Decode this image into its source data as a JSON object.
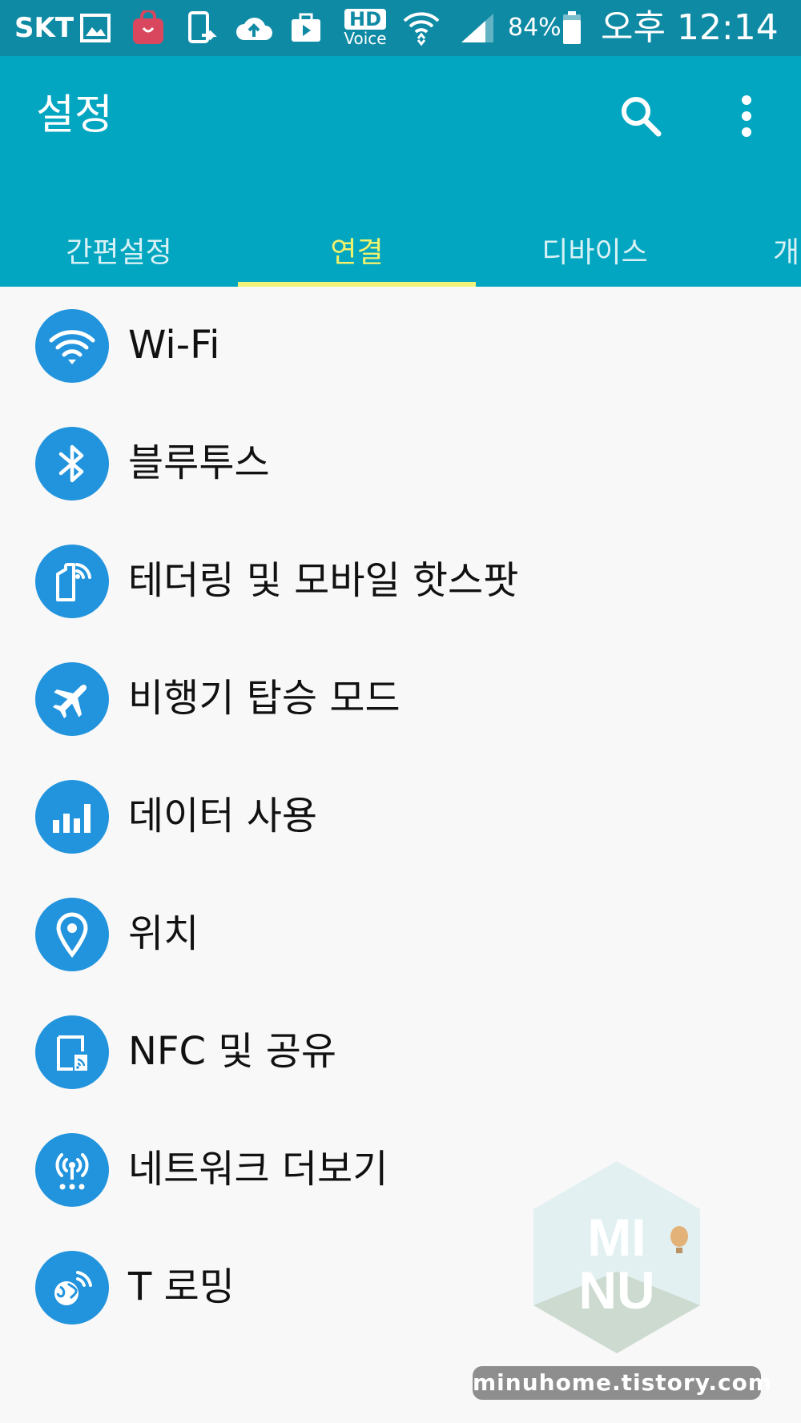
{
  "status_bar": {
    "carrier": "SKT",
    "hd_top": "HD",
    "hd_bottom": "Voice",
    "battery": "84%",
    "time": "오후 12:14",
    "icons": [
      "gallery-icon",
      "shopping-bag-icon",
      "phone-transfer-icon",
      "cloud-upload-icon",
      "briefcase-play-icon",
      "hd-voice-icon",
      "wifi-icon",
      "cell-signal-icon",
      "battery-icon"
    ]
  },
  "app_bar": {
    "title": "설정",
    "actions": [
      "search-icon",
      "more-vert-icon"
    ],
    "background": "#02a6c1"
  },
  "tabs": {
    "items": [
      {
        "label": "간편설정",
        "active": false
      },
      {
        "label": "연결",
        "active": true
      },
      {
        "label": "디바이스",
        "active": false
      },
      {
        "label": "개",
        "active": false
      }
    ],
    "active_color": "#f2f26b",
    "indicator_color": "#f0f27a"
  },
  "settings": {
    "icon_color": "#2294dd",
    "items": [
      {
        "label": "Wi-Fi",
        "icon": "wifi-icon"
      },
      {
        "label": "블루투스",
        "icon": "bluetooth-icon"
      },
      {
        "label": "테더링 및 모바일 핫스팟",
        "icon": "tethering-icon"
      },
      {
        "label": "비행기 탑승 모드",
        "icon": "airplane-icon"
      },
      {
        "label": "데이터 사용",
        "icon": "data-usage-icon"
      },
      {
        "label": "위치",
        "icon": "location-pin-icon"
      },
      {
        "label": "NFC 및 공유",
        "icon": "nfc-icon"
      },
      {
        "label": "네트워크 더보기",
        "icon": "network-antenna-icon"
      },
      {
        "label": "T 로밍",
        "icon": "roaming-globe-icon"
      }
    ]
  },
  "watermark": {
    "logo_line1": "MI",
    "logo_line2": "NU",
    "url": "minuhome.tistory.com"
  }
}
